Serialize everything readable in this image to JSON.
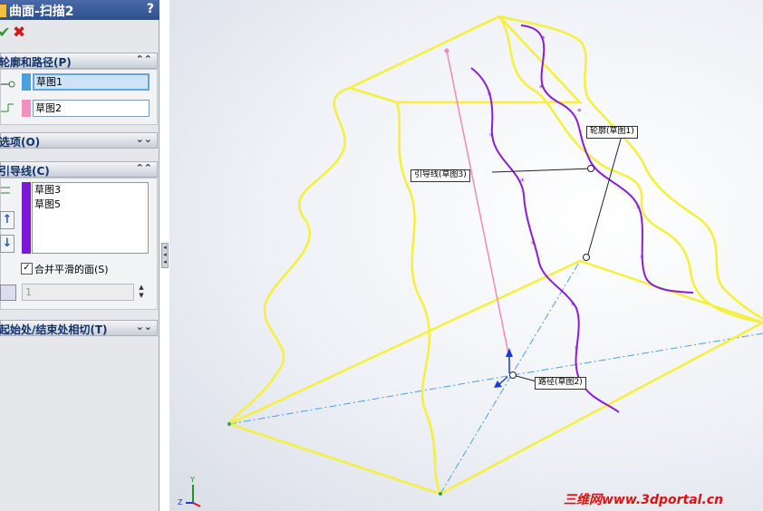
{
  "panel": {
    "title": "曲面-扫描2",
    "help": "?",
    "ok_icon": "checkmark-icon",
    "cancel_icon": "x-icon",
    "profile_path": {
      "header": "轮廓和路径(P)",
      "profile_value": "草图1",
      "path_value": "草图2",
      "profile_color": "#4aa0e0",
      "path_color": "#f090c0"
    },
    "options": {
      "header": "选项(O)"
    },
    "guides": {
      "header": "引导线(C)",
      "items": [
        "草图3",
        "草图5"
      ],
      "color": "#7a18d8",
      "merge_label": "合并平滑的面(S)",
      "merge_checked": true,
      "spin_value": "1"
    },
    "tangency": {
      "header": "起始处/结束处相切(T)"
    }
  },
  "viewport": {
    "callouts": {
      "profile": "轮廓(草图1)",
      "guide": "引导线(草图3)",
      "path": "路径(草图2)"
    },
    "triad": {
      "y": "Y",
      "z": "Z"
    },
    "colors": {
      "wire": "#f5f03a",
      "guide": "#8a1ed8",
      "path": "#f08ab8",
      "axis": "#4aa0e0"
    }
  },
  "watermark": "三维网www.3dportal.cn"
}
